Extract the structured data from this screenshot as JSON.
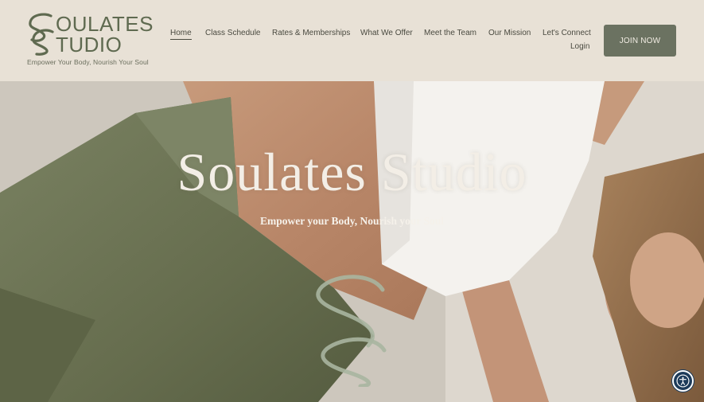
{
  "brand": {
    "name_line1": "OULATES",
    "name_line2": "TUDIO",
    "tagline": "Empower Your Body, Nourish Your Soul"
  },
  "nav": {
    "items": [
      {
        "label": "Home",
        "active": true
      },
      {
        "label": "Class Schedule"
      },
      {
        "label": "Rates & Memberships"
      },
      {
        "label": "What We Offer"
      },
      {
        "label": "Meet the Team"
      },
      {
        "label": "Our Mission"
      },
      {
        "label": "Let's Connect"
      }
    ],
    "login": "Login",
    "cta": "JOIN NOW"
  },
  "hero": {
    "title": "Soulates Studio",
    "subtitle": "Empower your Body, Nourish your Soul"
  },
  "icons": {
    "accessibility": "accessibility-icon",
    "logo": "soulates-s-logo-icon"
  },
  "colors": {
    "header_bg": "#e8e1d6",
    "brand_green": "#5f6a50",
    "button_bg": "#6b7261",
    "hero_text": "#f3eee6",
    "leggings": "#6d7456",
    "sage_mark": "#a8b5a0"
  }
}
